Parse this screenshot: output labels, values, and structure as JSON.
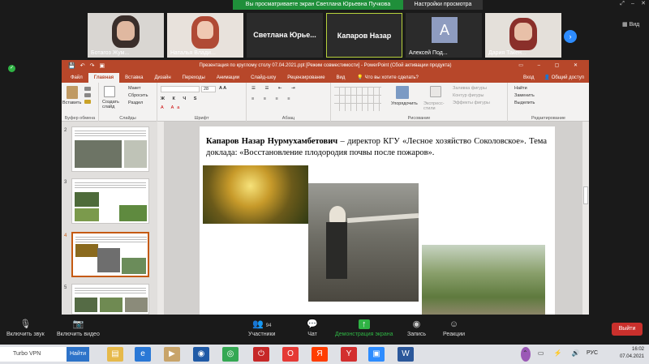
{
  "zoom": {
    "share_banner": "Вы просматриваете экран Светлана Юрьевна Пучкова",
    "view_options": "Настройки просмотра",
    "view_button": "Вид",
    "participants_count": "94",
    "participants": [
      {
        "name": "Ботагоз Жум..."
      },
      {
        "name": "Наталья Влади..."
      },
      {
        "name": "Светлана Юрье..."
      },
      {
        "name": "Капаров Назар"
      },
      {
        "name": "Алексей Под..."
      },
      {
        "name": "Дария Такен..."
      }
    ],
    "avatar_letter": "A",
    "controls": {
      "mute": "Включить звук",
      "video": "Включить видео",
      "participants": "Участники",
      "chat": "Чат",
      "share": "Демонстрация экрана",
      "record": "Запись",
      "reactions": "Реакции",
      "leave": "Выйти"
    }
  },
  "ppt": {
    "title": "Презентация по круглому столу 07.04.2021.ppt [Режим совместимости] - PowerPoint (Сбой активации продукта)",
    "tabs": [
      "Файл",
      "Главная",
      "Вставка",
      "Дизайн",
      "Переходы",
      "Анимации",
      "Слайд-шоу",
      "Рецензирование",
      "Вид"
    ],
    "search": "Что вы хотите сделать?",
    "login": "Вход",
    "share": "Общий доступ",
    "ribbon": {
      "paste": "Вставить",
      "clipboard": "Буфер обмена",
      "new_slide": "Создать слайд",
      "layout": "Макет",
      "reset": "Сбросить",
      "section": "Раздел",
      "slides": "Слайды",
      "font_size": "28",
      "font": "Шрифт",
      "paragraph": "Абзац",
      "arrange": "Упорядочить",
      "quick_styles": "Экспресс-стили",
      "drawing": "Рисование",
      "fill": "Заливка фигуры",
      "outline": "Контур фигуры",
      "effects": "Эффекты фигуры",
      "find": "Найти",
      "replace": "Заменить",
      "select": "Выделить",
      "editing": "Редактирование"
    },
    "slide_numbers": [
      "2",
      "3",
      "4",
      "5"
    ],
    "slide": {
      "name": "Капаров Назар Нурмухамбетович",
      "text": " – директор КГУ «Лесное хозяйство Соколовское». Тема доклада: «Восстановление плодородия почвы после пожаров»."
    }
  },
  "taskbar": {
    "vpn": "Turbo VPN",
    "go": "Найти",
    "lang": "РУС",
    "time": "16:02",
    "date": "07.04.2021"
  }
}
